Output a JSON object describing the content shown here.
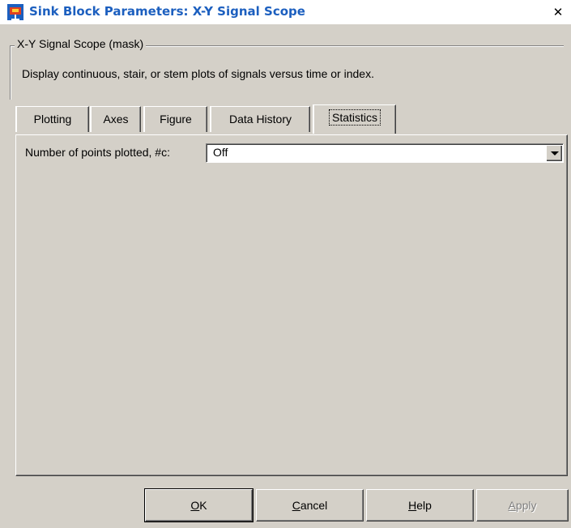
{
  "window": {
    "title": "Sink Block Parameters: X-Y Signal Scope",
    "close_glyph": "✕"
  },
  "group": {
    "title": "X-Y Signal Scope (mask)",
    "description": "Display continuous, stair, or stem plots of signals versus time or index."
  },
  "tabs": [
    {
      "label": "Plotting"
    },
    {
      "label": "Axes"
    },
    {
      "label": "Figure"
    },
    {
      "label": "Data History"
    },
    {
      "label": "Statistics",
      "active": true
    }
  ],
  "statistics": {
    "points_label": "Number of points plotted, #c:",
    "points_value": "Off"
  },
  "buttons": {
    "ok": {
      "mnemonic": "O",
      "rest": "K"
    },
    "cancel": {
      "mnemonic": "C",
      "rest": "ancel"
    },
    "help": {
      "mnemonic": "H",
      "rest": "elp"
    },
    "apply": {
      "mnemonic": "A",
      "rest": "pply"
    }
  },
  "icons": {
    "app": "simulink-block-icon"
  },
  "colors": {
    "title_text": "#1c5fbf",
    "face": "#d4d0c8"
  }
}
